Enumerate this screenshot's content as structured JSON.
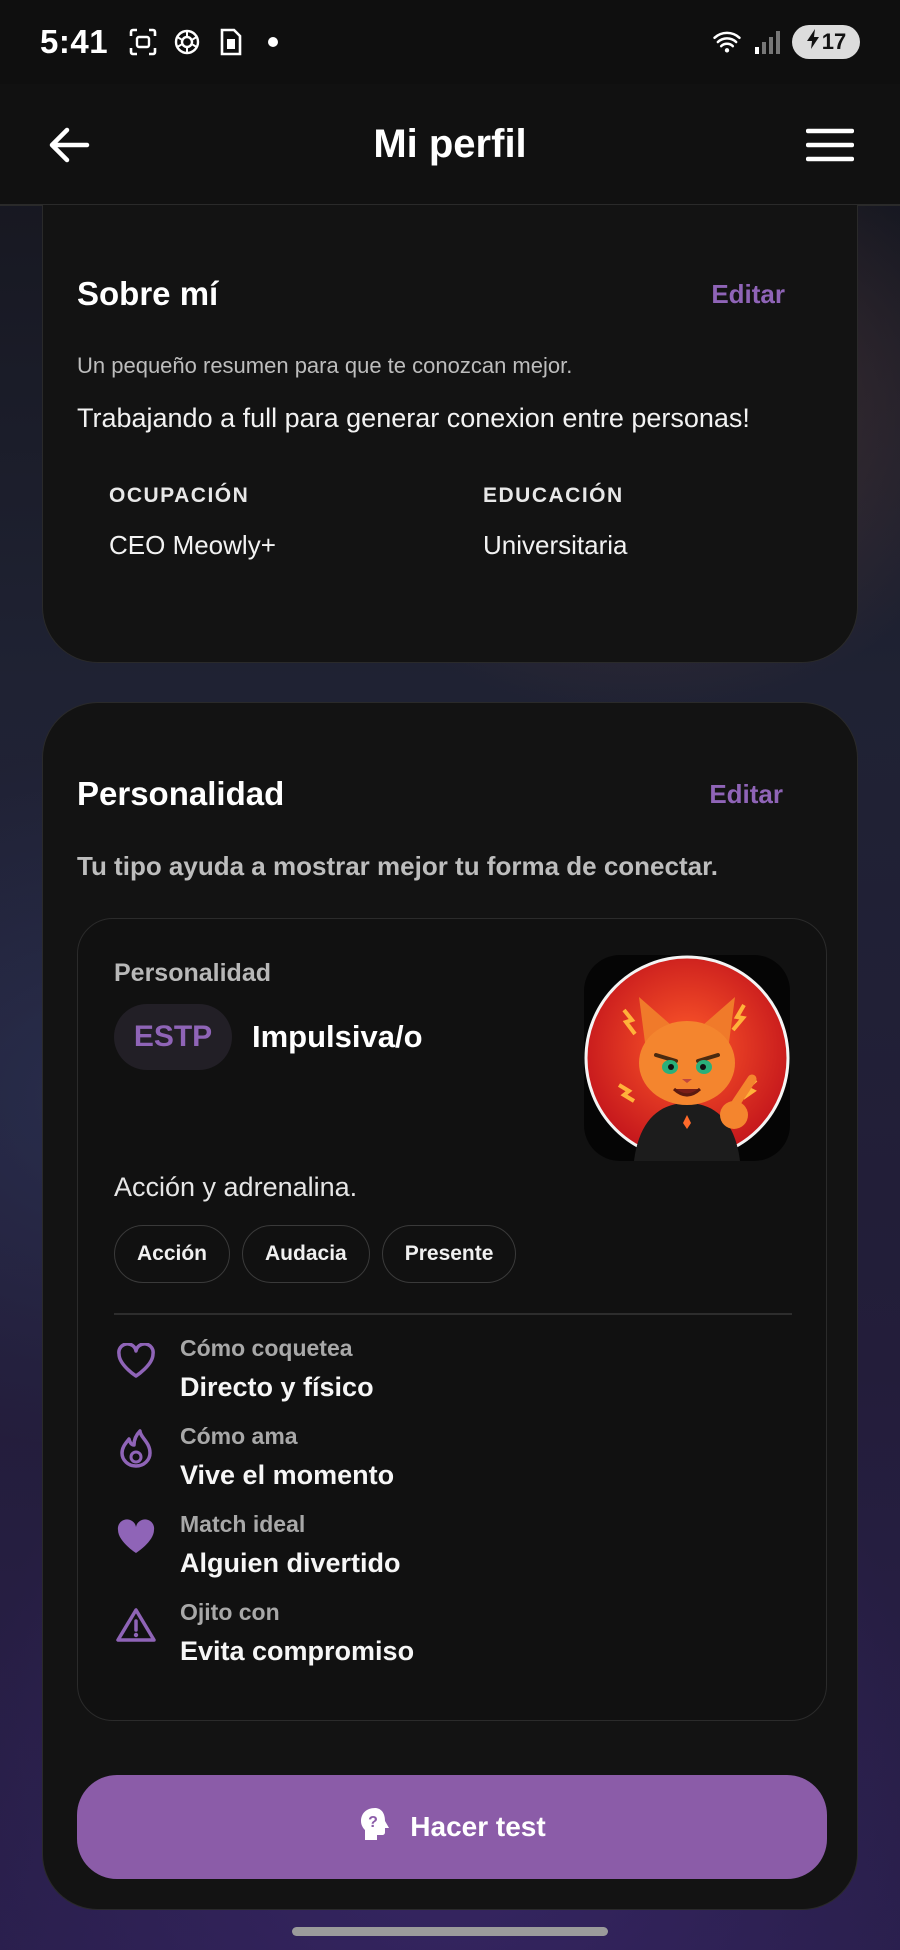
{
  "status_bar": {
    "time": "5:41",
    "battery_level": "17",
    "icons": [
      "screenshot-icon",
      "openai-icon",
      "sim-card-icon",
      "wifi-icon",
      "signal-icon",
      "battery-charging-icon"
    ]
  },
  "header": {
    "title": "Mi perfil",
    "back_icon": "arrow-left-icon",
    "menu_icon": "hamburger-menu-icon"
  },
  "about": {
    "title": "Sobre mí",
    "edit_label": "Editar",
    "subtitle": "Un pequeño resumen para que te conozcan mejor.",
    "text": "Trabajando a full para generar conexion entre personas!",
    "occupation_label": "OCUPACIÓN",
    "occupation_value": "CEO Meowly+",
    "education_label": "EDUCACIÓN",
    "education_value": "Universitaria"
  },
  "personality": {
    "title": "Personalidad",
    "edit_label": "Editar",
    "subtitle": "Tu tipo ayuda a mostrar mejor tu forma de conectar.",
    "label": "Personalidad",
    "type_code": "ESTP",
    "type_name": "Impulsiva/o",
    "description": "Acción y adrenalina.",
    "tags": [
      "Acción",
      "Audacia",
      "Presente"
    ],
    "traits": [
      {
        "icon": "heart-outline-icon",
        "label": "Cómo coquetea",
        "value": "Directo y físico"
      },
      {
        "icon": "flame-icon",
        "label": "Cómo ama",
        "value": "Vive el momento"
      },
      {
        "icon": "heart-filled-icon",
        "label": "Match ideal",
        "value": "Alguien divertido"
      },
      {
        "icon": "warning-icon",
        "label": "Ojito con",
        "value": "Evita compromiso"
      }
    ],
    "test_button_label": "Hacer test"
  },
  "colors": {
    "accent": "#8f64b7",
    "button": "#8b5ca8",
    "card": "#131313"
  }
}
